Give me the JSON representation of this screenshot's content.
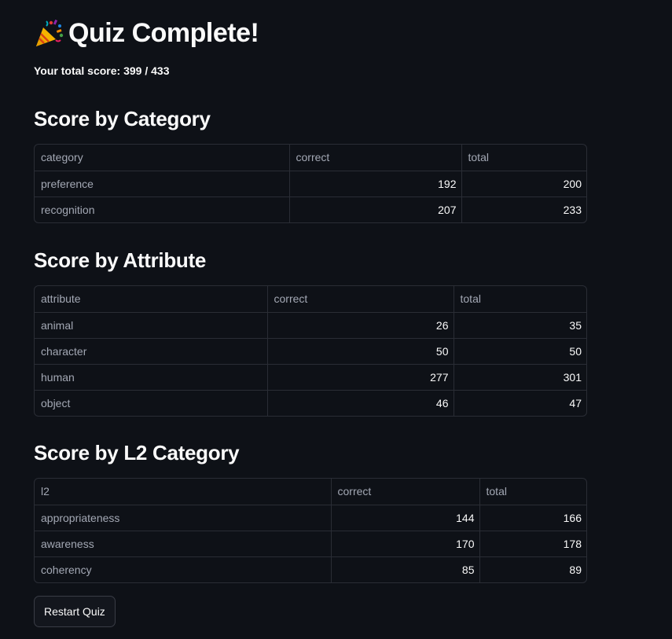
{
  "header": {
    "icon": "party-popper-icon",
    "title": "Quiz Complete!",
    "score_text": "Your total score: 399 / 433"
  },
  "sections": {
    "category": {
      "heading": "Score by Category",
      "columns": [
        "category",
        "correct",
        "total"
      ],
      "rows": [
        [
          "preference",
          "192",
          "200"
        ],
        [
          "recognition",
          "207",
          "233"
        ]
      ]
    },
    "attribute": {
      "heading": "Score by Attribute",
      "columns": [
        "attribute",
        "correct",
        "total"
      ],
      "rows": [
        [
          "animal",
          "26",
          "35"
        ],
        [
          "character",
          "50",
          "50"
        ],
        [
          "human",
          "277",
          "301"
        ],
        [
          "object",
          "46",
          "47"
        ]
      ]
    },
    "l2": {
      "heading": "Score by L2 Category",
      "columns": [
        "l2",
        "correct",
        "total"
      ],
      "rows": [
        [
          "appropriateness",
          "144",
          "166"
        ],
        [
          "awareness",
          "170",
          "178"
        ],
        [
          "coherency",
          "85",
          "89"
        ]
      ]
    }
  },
  "actions": {
    "restart_label": "Restart Quiz"
  },
  "colors": {
    "background": "#0e1117",
    "text": "#fafafa",
    "muted_text": "#a3a8b4",
    "border": "#2a2d35"
  }
}
